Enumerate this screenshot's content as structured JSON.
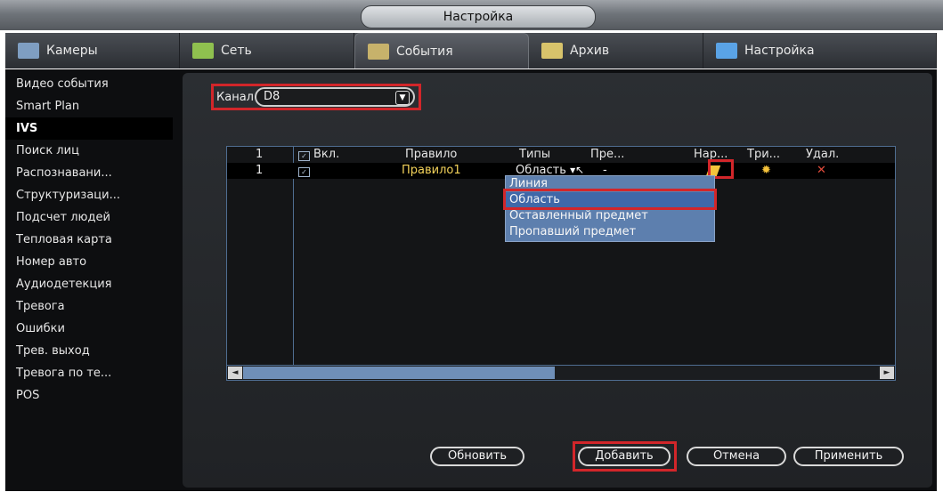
{
  "window": {
    "title": "Настройка"
  },
  "tabs": [
    {
      "label": "Камеры",
      "icon": "camera-icon",
      "active": false
    },
    {
      "label": "Сеть",
      "icon": "network-icon",
      "active": false
    },
    {
      "label": "События",
      "icon": "events-icon",
      "active": true
    },
    {
      "label": "Архив",
      "icon": "archive-icon",
      "active": false
    },
    {
      "label": "Настройка",
      "icon": "settings-icon",
      "active": false
    }
  ],
  "sidebar": {
    "items": [
      {
        "label": "Видео события"
      },
      {
        "label": "Smart Plan"
      },
      {
        "label": "IVS",
        "active": true
      },
      {
        "label": "Поиск лиц"
      },
      {
        "label": "Распознавани..."
      },
      {
        "label": "Структуризаци..."
      },
      {
        "label": "Подсчет людей"
      },
      {
        "label": "Тепловая карта"
      },
      {
        "label": "Номер авто"
      },
      {
        "label": "Аудиодетекция"
      },
      {
        "label": "Тревога"
      },
      {
        "label": "Ошибки"
      },
      {
        "label": "Трев. выход"
      },
      {
        "label": "Тревога по те..."
      },
      {
        "label": "POS"
      }
    ]
  },
  "channel": {
    "label": "Канал",
    "value": "D8"
  },
  "table": {
    "headers": {
      "num": "1",
      "enable": "Вкл.",
      "rule": "Правило",
      "types": "Типы",
      "pre": "Пре...",
      "draw": "Нар...",
      "trigger": "Три...",
      "delete": "Удал."
    },
    "rows": [
      {
        "num": "1",
        "rule": "Правило1",
        "type": "Область",
        "pre": "-"
      }
    ]
  },
  "type_dropdown": {
    "options": [
      "Линия",
      "Область",
      "Оставленный предмет",
      "Пропавший предмет"
    ],
    "selected": "Область"
  },
  "buttons": {
    "refresh": "Обновить",
    "add": "Добавить",
    "cancel": "Отмена",
    "apply": "Применить"
  },
  "colors": {
    "highlight": "#d2262a",
    "selection": "#3f68a8"
  }
}
